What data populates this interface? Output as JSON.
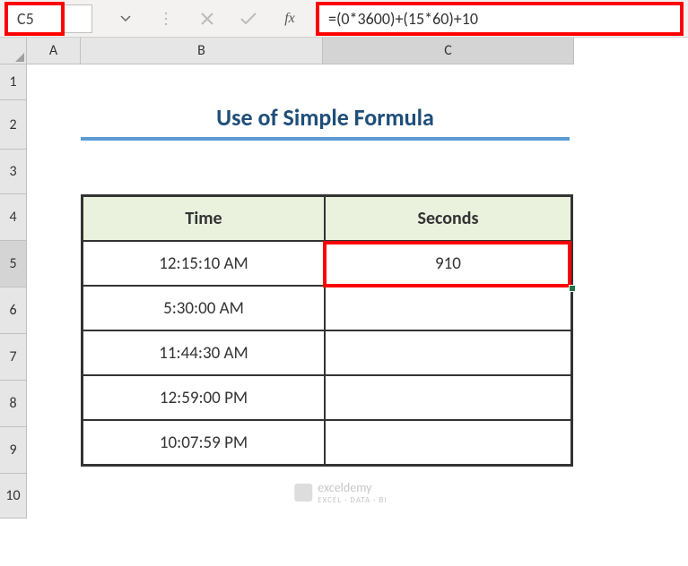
{
  "namebox": {
    "value": "C5"
  },
  "formula": {
    "value": "=(0*3600)+(15*60)+10"
  },
  "columns": {
    "a": "A",
    "b": "B",
    "c": "C"
  },
  "rows": {
    "r1": "1",
    "r2": "2",
    "r3": "3",
    "r4": "4",
    "r5": "5",
    "r6": "6",
    "r7": "7",
    "r8": "8",
    "r9": "9",
    "r10": "10"
  },
  "title": "Use of Simple Formula",
  "headers": {
    "time": "Time",
    "seconds": "Seconds"
  },
  "data": {
    "r1_time": "12:15:10 AM",
    "r1_sec": "910",
    "r2_time": "5:30:00 AM",
    "r2_sec": "",
    "r3_time": "11:44:30 AM",
    "r3_sec": "",
    "r4_time": "12:59:00 PM",
    "r4_sec": "",
    "r5_time": "10:07:59 PM",
    "r5_sec": ""
  },
  "watermark": {
    "name": "exceldemy",
    "sub": "EXCEL · DATA · BI"
  },
  "chart_data": {
    "type": "table",
    "title": "Use of Simple Formula",
    "columns": [
      "Time",
      "Seconds"
    ],
    "rows": [
      [
        "12:15:10 AM",
        910
      ],
      [
        "5:30:00 AM",
        null
      ],
      [
        "11:44:30 AM",
        null
      ],
      [
        "12:59:00 PM",
        null
      ],
      [
        "10:07:59 PM",
        null
      ]
    ],
    "selected_cell": "C5",
    "formula": "=(0*3600)+(15*60)+10"
  }
}
